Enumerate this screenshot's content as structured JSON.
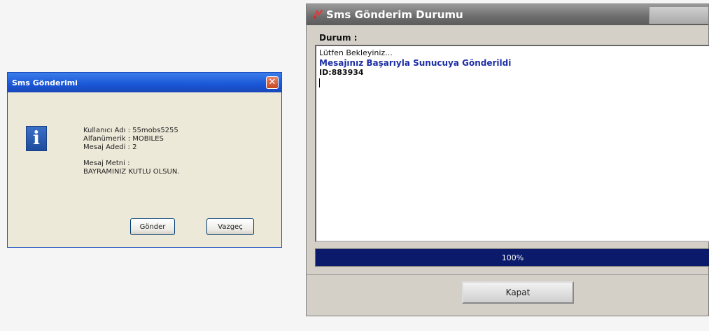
{
  "send_dialog": {
    "title": "Sms Gönderimi",
    "close_glyph": "✕",
    "icon": "info-icon",
    "lines": [
      "Kullanıcı Adı : 55mobs5255",
      "Alfanümerik : MOBILES",
      "Mesaj Adedi : 2"
    ],
    "message_label": "Mesaj Metni :",
    "message_text": "BAYRAMINIZ KUTLU OLSUN.",
    "send_button": "Gönder",
    "cancel_button": "Vazgeç"
  },
  "status_window": {
    "title": "Sms Gönderim Durumu",
    "icon": "sms-app-icon",
    "status_label": "Durum :",
    "log_lines": {
      "wait": "Lütfen Bekleyiniz...",
      "success": "Mesajınız Başarıyla Sunucuya Gönderildi",
      "id": "ID:883934"
    },
    "progress": {
      "value": 1.0,
      "text": "100%"
    },
    "close_button": "Kapat"
  },
  "colors": {
    "xp_title_blue": "#1a56d6",
    "progress_navy": "#0a1f6e",
    "success_text": "#1d2fa6"
  }
}
